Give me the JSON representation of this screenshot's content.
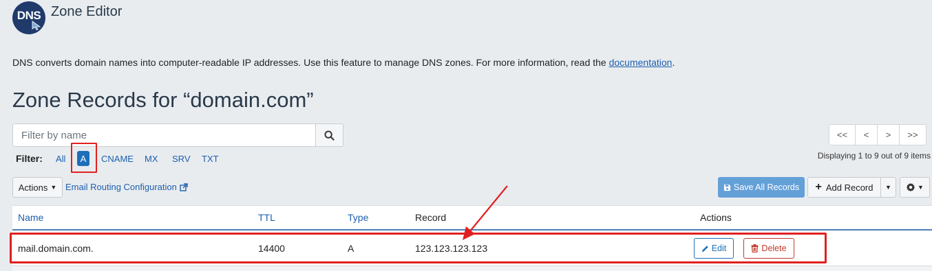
{
  "app": {
    "title": "Zone Editor",
    "logo_text": "DNS"
  },
  "description": {
    "text": "DNS converts domain names into computer-readable IP addresses. Use this feature to manage DNS zones. For more information, read the ",
    "link": "documentation",
    "suffix": "."
  },
  "page_title": "Zone Records for “domain.com”",
  "search": {
    "placeholder": "Filter by name",
    "value": ""
  },
  "filter": {
    "label": "Filter:",
    "options": [
      "All",
      "A",
      "CNAME",
      "MX",
      "SRV",
      "TXT"
    ],
    "active": "A"
  },
  "pagination": {
    "first": "<<",
    "prev": "<",
    "next": ">",
    "last": ">>",
    "status": "Displaying 1 to 9 out of 9 items"
  },
  "toolbar": {
    "actions_label": "Actions",
    "email_routing": "Email Routing Configuration",
    "save_all": "Save All Records",
    "add_record": "Add Record"
  },
  "table": {
    "columns": [
      "Name",
      "TTL",
      "Type",
      "Record",
      "Actions"
    ],
    "rows": [
      {
        "name": "mail.domain.com.",
        "ttl": "14400",
        "type": "A",
        "record": "123.123.123.123",
        "edit": "Edit",
        "delete": "Delete"
      }
    ]
  },
  "colors": {
    "accent": "#1c6fb8",
    "annotation": "#e02020",
    "danger": "#c0392b",
    "save_button": "#64a0d8"
  }
}
